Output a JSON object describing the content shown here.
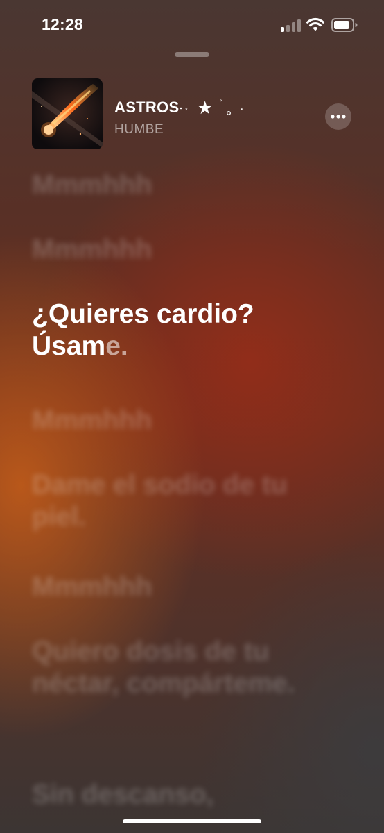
{
  "status_bar": {
    "time": "12:28",
    "icons": [
      "cellular-signal-icon",
      "wifi-icon",
      "battery-icon"
    ]
  },
  "now_playing": {
    "title": "ASTROS",
    "artist": "HUMBE",
    "more_icon": "ellipsis-icon"
  },
  "lyrics": {
    "past": [
      "Mmmhhh",
      "Mmmhhh"
    ],
    "current": {
      "line1": "¿Quieres cardio?",
      "line2_sung": "Úsam",
      "line2_unsung": "e."
    },
    "upcoming": [
      "Mmmhhh",
      "Dame el sodio de tu piel.",
      "Mmmhhh",
      "Quiero dosis de tu néctar, compárteme.",
      "Sin descanso,"
    ]
  },
  "colors": {
    "text": "#ffffff",
    "background_warm": "#c85f19",
    "background_dark": "#3c3533"
  }
}
